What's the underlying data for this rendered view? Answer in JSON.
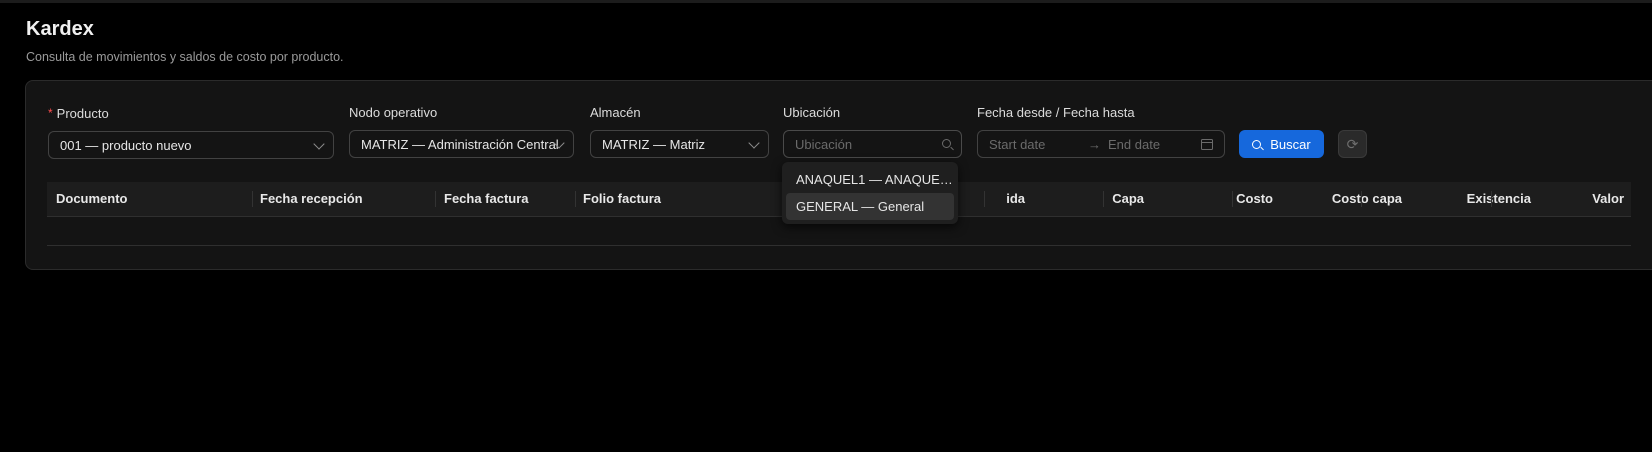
{
  "page": {
    "title": "Kardex",
    "subtitle": "Consulta de movimientos y saldos de costo por producto."
  },
  "filters": {
    "producto": {
      "label": "Producto",
      "required_mark": "*",
      "value": "001 — producto nuevo"
    },
    "nodo": {
      "label": "Nodo operativo",
      "value": "MATRIZ — Administración Central"
    },
    "almacen": {
      "label": "Almacén",
      "value": "MATRIZ — Matriz"
    },
    "ubicacion": {
      "label": "Ubicación",
      "placeholder": "Ubicación",
      "value": ""
    },
    "fechas": {
      "label": "Fecha desde / Fecha hasta",
      "start_placeholder": "Start date",
      "end_placeholder": "End date",
      "separator": "→"
    }
  },
  "buttons": {
    "buscar": "Buscar",
    "reset_icon": "reload-icon"
  },
  "table": {
    "columns": [
      "Documento",
      "Fecha recepción",
      "Fecha factura",
      "Folio factura",
      "ida",
      "Capa",
      "Costo",
      "Costo capa",
      "Existencia",
      "Valor"
    ],
    "rows": []
  },
  "ubicacion_dropdown": {
    "options": [
      "ANAQUEL1 — ANAQUEL...",
      "GENERAL — General"
    ],
    "highlighted": "GENERAL — General"
  }
}
